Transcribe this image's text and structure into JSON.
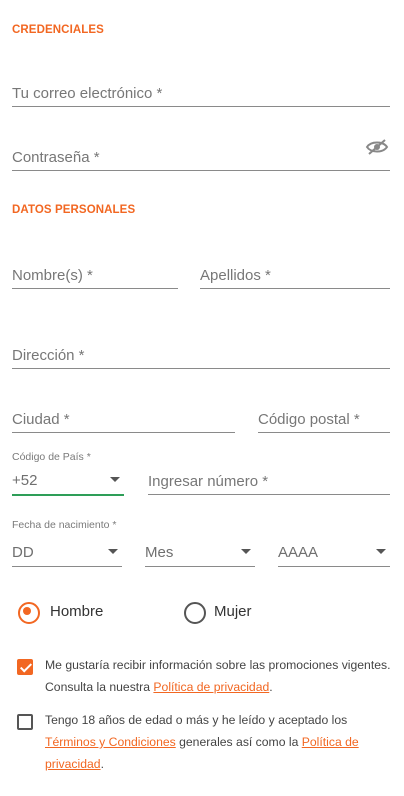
{
  "credentials": {
    "title": "CREDENCIALES",
    "email_placeholder": "Tu correo electrónico *",
    "password_placeholder": "Contraseña *",
    "visibility_icon": "eye-off-icon"
  },
  "personal": {
    "title": "DATOS PERSONALES",
    "first_name_placeholder": "Nombre(s) *",
    "last_name_placeholder": "Apellidos *",
    "address_placeholder": "Dirección *",
    "city_placeholder": "Ciudad *",
    "postal_placeholder": "Código postal *",
    "country_code_label": "Código de País *",
    "country_code_value": "+52",
    "phone_placeholder": "Ingresar número *",
    "birth_label": "Fecha de nacimiento *",
    "day_value": "DD",
    "month_value": "Mes",
    "year_value": "AAAA"
  },
  "gender": {
    "options": [
      "Hombre",
      "Mujer"
    ],
    "selected": "Hombre"
  },
  "consents": {
    "promotions_text": "Me gustaría recibir información sobre las promociones vigentes. Consulta la nuestra ",
    "promotions_link": "Política de privacidad",
    "promotions_end": ".",
    "promotions_checked": true,
    "age_text_1": "Tengo 18 años de edad o más y he leído y aceptado los ",
    "age_link_1": "Términos y Condiciones",
    "age_text_2": " generales así como la ",
    "age_link_2": "Política de privacidad",
    "age_end": ".",
    "age_checked": false
  },
  "colors": {
    "accent": "#f26722",
    "active_underline": "#2e9e58"
  }
}
